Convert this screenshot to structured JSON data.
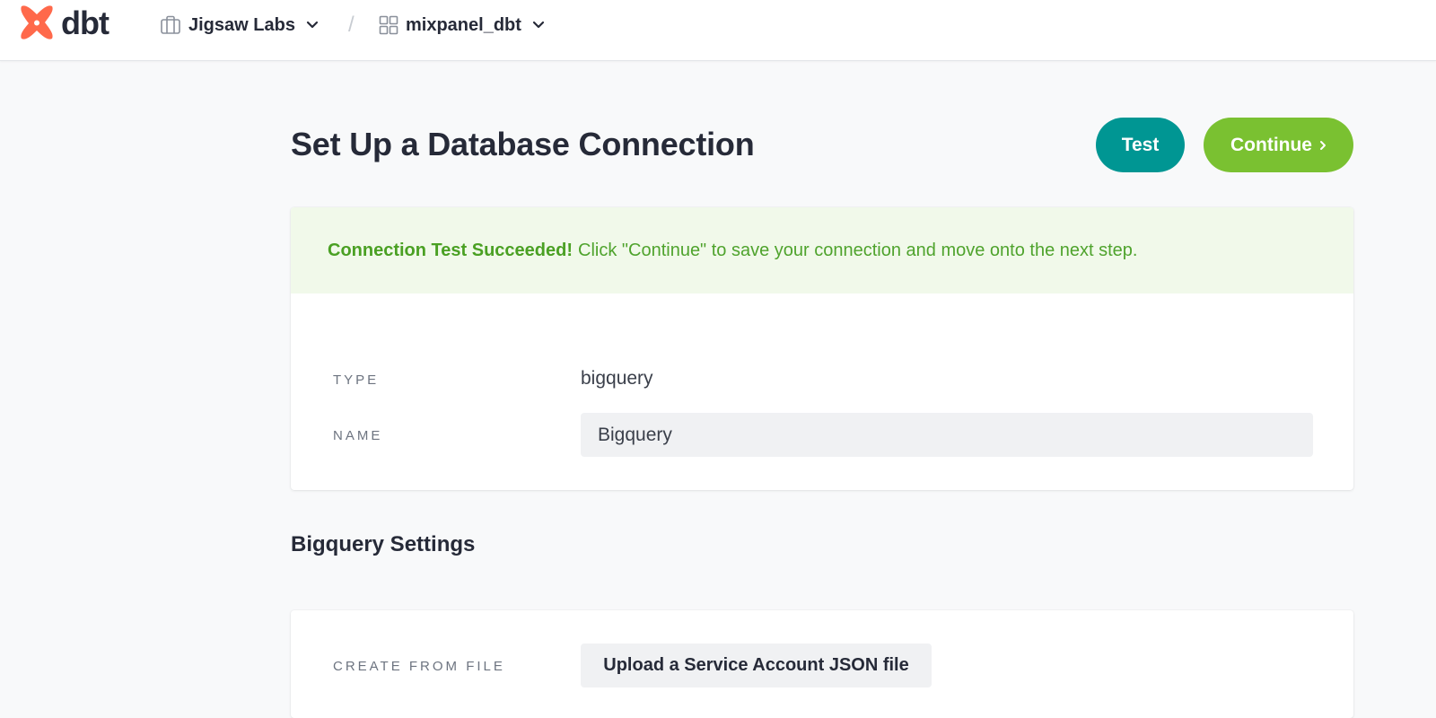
{
  "brand": {
    "logo_text": "dbt",
    "logo_color": "#ff694b"
  },
  "breadcrumb": {
    "account": {
      "label": "Jigsaw Labs",
      "icon": "briefcase-icon"
    },
    "separator": "/",
    "project": {
      "label": "mixpanel_dbt",
      "icon": "grid-icon"
    }
  },
  "page": {
    "title": "Set Up a Database Connection",
    "test_label": "Test",
    "continue_label": "Continue"
  },
  "alert": {
    "strong": "Connection Test Succeeded!",
    "message": "Click \"Continue\" to save your connection and move onto the next step."
  },
  "connection": {
    "type_label": "TYPE",
    "type_value": "bigquery",
    "name_label": "NAME",
    "name_value": "Bigquery"
  },
  "bigquery_settings": {
    "title": "Bigquery Settings",
    "create_from_file_label": "CREATE FROM FILE",
    "upload_label": "Upload a Service Account JSON file"
  },
  "colors": {
    "test_button": "#009693",
    "continue_button": "#7ac131",
    "alert_bg": "#f1f9ea",
    "alert_text": "#4fa32d"
  }
}
